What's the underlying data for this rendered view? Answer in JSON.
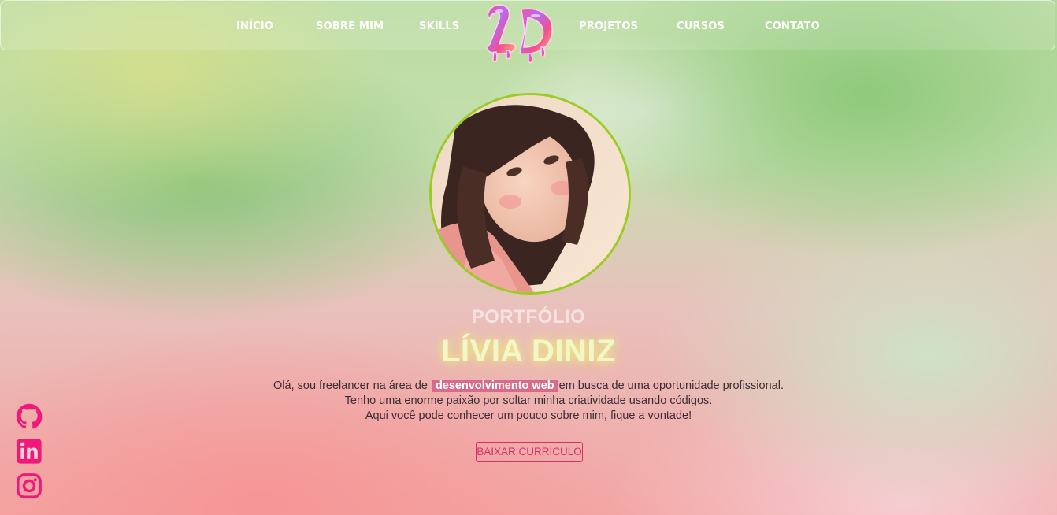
{
  "nav": {
    "left_links": [
      "INÍCIO",
      "SOBRE MIM",
      "SKILLS"
    ],
    "right_links": [
      "PROJETOS",
      "CURSOS",
      "CONTATO"
    ],
    "logo_text": "LD"
  },
  "hero": {
    "eyebrow": "PORTFÓLIO",
    "name": "LÍVIA DINIZ",
    "bio_line1_pre": "Olá, sou freelancer na área de",
    "bio_highlight": "desenvolvimento web",
    "bio_line1_post": "em busca de uma oportunidade profissional.",
    "bio_line2": "Tenho uma enorme paixão por soltar minha criatividade usando códigos.",
    "bio_line3": "Aqui você pode conhecer um pouco sobre mim, fique a vontade!",
    "cv_button": "BAIXAR CURRÍCULO"
  },
  "social_icons": [
    "github-icon",
    "linkedin-icon",
    "instagram-icon"
  ],
  "colors": {
    "accent_pink": "#d5326d",
    "icon_pink": "#f0187a",
    "avatar_border": "#9ccc24",
    "name_glow": "#eef078",
    "highlight_bg": "#d86b89"
  }
}
